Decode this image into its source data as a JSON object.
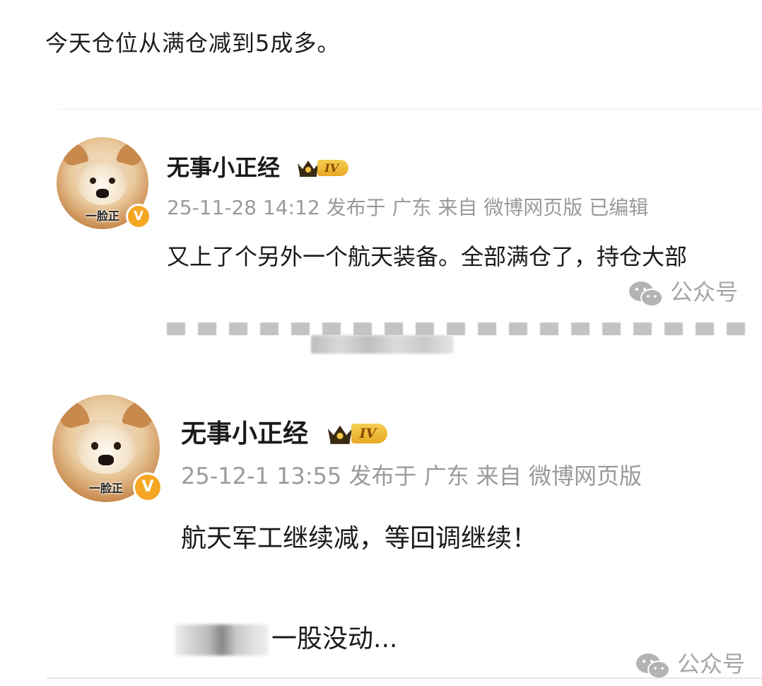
{
  "intro_text": "今天仓位从满仓减到5成多。",
  "posts": [
    {
      "username": "无事小正经",
      "level": "IV",
      "avatar_caption": "一脸正",
      "verified_badge": "V",
      "meta": "25-11-28 14:12 发布于 广东 来自 微博网页版 已编辑",
      "content": "又上了个另外一个航天装备。全部满仓了，持仓大部"
    },
    {
      "username": "无事小正经",
      "level": "IV",
      "avatar_caption": "一脸正",
      "verified_badge": "V",
      "meta": "25-12-1 13:55 发布于 广东 来自 微博网页版",
      "content": "航天军工继续减，等回调继续！",
      "content_line2": "一股没动..."
    }
  ],
  "watermark": {
    "text": "公众号",
    "icon": "wechat-icon"
  },
  "colors": {
    "meta_gray": "#9a9a9a",
    "badge_orange": "#f6a623",
    "level_gold": "#e7a824"
  }
}
